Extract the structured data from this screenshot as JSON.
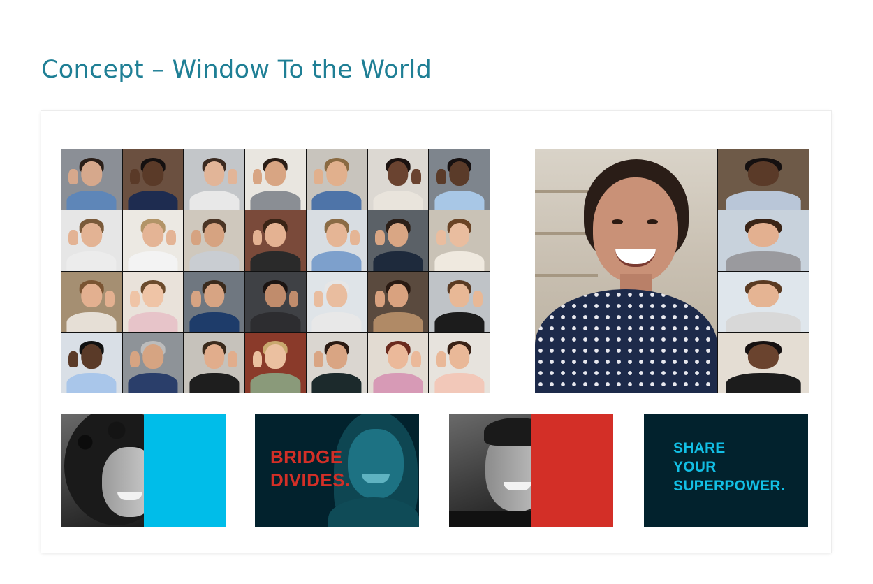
{
  "header": {
    "title": "Concept – Window To the World"
  },
  "colors": {
    "title_teal": "#1f7f95",
    "cyan_accent": "#00bde9",
    "red_accent": "#d32f27",
    "dark_navy": "#02222d"
  },
  "video_grid": {
    "rows": 4,
    "columns": 7,
    "tiles": [
      {
        "bg": "#8b8f96",
        "skin": "#d6a88c",
        "hair": "#2a1e18",
        "shirt": "#5e86b8"
      },
      {
        "bg": "#6b5040",
        "skin": "#5a3a28",
        "hair": "#141010",
        "shirt": "#1e2c50"
      },
      {
        "bg": "#c3c6c9",
        "skin": "#e2b598",
        "hair": "#3b2a20",
        "shirt": "#e8e8e8"
      },
      {
        "bg": "#e9e6e0",
        "skin": "#d8a583",
        "hair": "#2a1d16",
        "shirt": "#8a8e94"
      },
      {
        "bg": "#c8c4bd",
        "skin": "#e1b08d",
        "hair": "#8a6a42",
        "shirt": "#4e74a8"
      },
      {
        "bg": "#dcd8d2",
        "skin": "#6a4330",
        "hair": "#1b1210",
        "shirt": "#e9e4dc"
      },
      {
        "bg": "#7e858d",
        "skin": "#5a3b29",
        "hair": "#161111",
        "shirt": "#a8c7e6"
      },
      {
        "bg": "#e6e6e6",
        "skin": "#e3b394",
        "hair": "#7a5a3a",
        "shirt": "#ececec"
      },
      {
        "bg": "#ece9e3",
        "skin": "#e4b495",
        "hair": "#b29468",
        "shirt": "#f3f3f3"
      },
      {
        "bg": "#cfc8bd",
        "skin": "#d6a381",
        "hair": "#4a3424",
        "shirt": "#c9cdd2"
      },
      {
        "bg": "#7a4a3a",
        "skin": "#e4b292",
        "hair": "#3a2416",
        "shirt": "#2a2a2a"
      },
      {
        "bg": "#d8dde2",
        "skin": "#e5b595",
        "hair": "#8a6b45",
        "shirt": "#7da0cc"
      },
      {
        "bg": "#5b6167",
        "skin": "#d9a684",
        "hair": "#2b1f18",
        "shirt": "#1e2a3c"
      },
      {
        "bg": "#c9c2b6",
        "skin": "#e9bd9f",
        "hair": "#6a4426",
        "shirt": "#efe9df"
      },
      {
        "bg": "#a58f72",
        "skin": "#e3b090",
        "hair": "#7a5432",
        "shirt": "#e6dfd6"
      },
      {
        "bg": "#e9e2da",
        "skin": "#efc4a6",
        "hair": "#6b4a2c",
        "shirt": "#e7c4c9"
      },
      {
        "bg": "#6f7780",
        "skin": "#d7a483",
        "hair": "#3a2a1c",
        "shirt": "#1e3c6a"
      },
      {
        "bg": "#3f4145",
        "skin": "#c08c6c",
        "hair": "#1b1412",
        "shirt": "#2d2d30"
      },
      {
        "bg": "#dfe4e8",
        "skin": "#e9bd9f",
        "hair": "#e6e6e6",
        "shirt": "#e8e8e8"
      },
      {
        "bg": "#5a4a3e",
        "skin": "#d9a27f",
        "hair": "#2a1a12",
        "shirt": "#b08a66"
      },
      {
        "bg": "#bfc3c7",
        "skin": "#e8b896",
        "hair": "#5a3a22",
        "shirt": "#1c1c1c"
      },
      {
        "bg": "#d9dfe6",
        "skin": "#5a3a28",
        "hair": "#111",
        "shirt": "#a9c6ea"
      },
      {
        "bg": "#8e9398",
        "skin": "#d6a482",
        "hair": "#bcbcbc",
        "shirt": "#2a3e6a"
      },
      {
        "bg": "#c6c2bb",
        "skin": "#e1ad8c",
        "hair": "#3a2a1c",
        "shirt": "#1e1e1e"
      },
      {
        "bg": "#8a3a2a",
        "skin": "#ebc0a0",
        "hair": "#c9a86e",
        "shirt": "#8a9a7a"
      },
      {
        "bg": "#dad6d0",
        "skin": "#d9a583",
        "hair": "#2a1a12",
        "shirt": "#1c2a2c"
      },
      {
        "bg": "#e2dbd2",
        "skin": "#ebb99a",
        "hair": "#6a2a1e",
        "shirt": "#d79ab6"
      },
      {
        "bg": "#e7e3dd",
        "skin": "#e9b898",
        "hair": "#3a2216",
        "shirt": "#f2c8b9"
      }
    ]
  },
  "speaker_panel": {
    "side_feeds": [
      {
        "bg": "#6e5a48",
        "skin": "#5a3a28",
        "hair": "#151010",
        "shirt": "#b9c6d8"
      },
      {
        "bg": "#c8d2dc",
        "skin": "#e3b090",
        "hair": "#3a2416",
        "shirt": "#9a9a9e"
      },
      {
        "bg": "#dfe6ec",
        "skin": "#e5b493",
        "hair": "#5a3a22",
        "shirt": "#d8d8d8"
      },
      {
        "bg": "#e4ddd3",
        "skin": "#6a432e",
        "hair": "#161111",
        "shirt": "#1c1c1c"
      }
    ]
  },
  "cards": [
    {
      "type": "split",
      "accent": "#00bde9"
    },
    {
      "type": "text",
      "lines": "BRIDGE\nDIVIDES.",
      "text_color": "#d32f27"
    },
    {
      "type": "split",
      "accent": "#d32f27"
    },
    {
      "type": "text",
      "lines": "SHARE\nYOUR\nSUPERPOWER.",
      "text_color": "#12bfe5"
    }
  ]
}
